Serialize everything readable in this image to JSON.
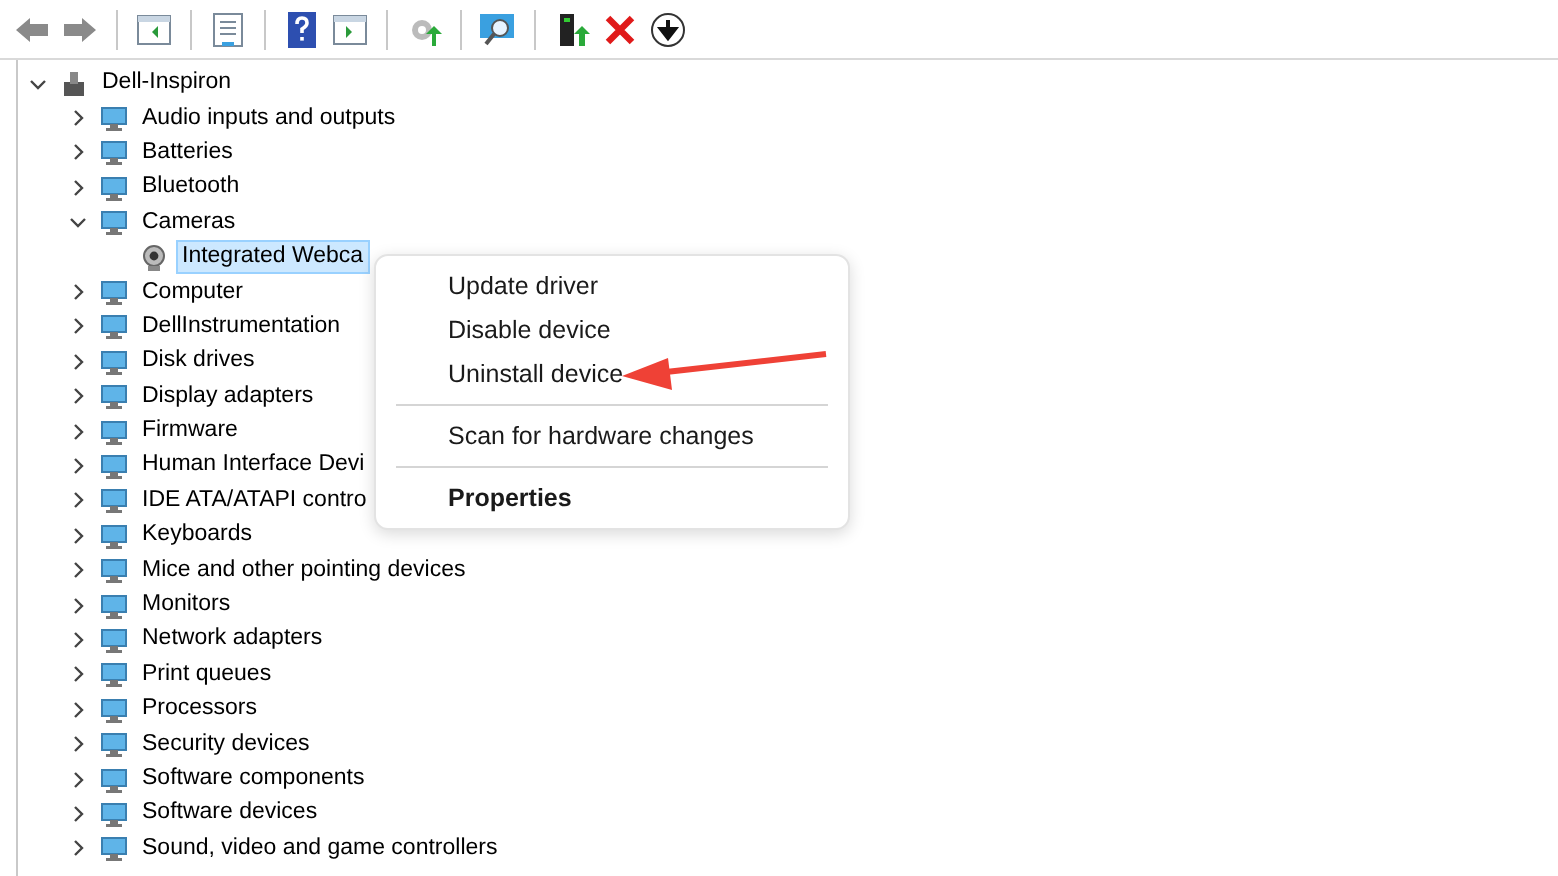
{
  "tree": {
    "label": "Dell-Inspiron",
    "expanded": true,
    "children": [
      {
        "label": "Audio inputs and outputs",
        "expanded": false
      },
      {
        "label": "Batteries",
        "expanded": false
      },
      {
        "label": "Bluetooth",
        "expanded": false
      },
      {
        "label": "Cameras",
        "expanded": true,
        "children": [
          {
            "label": "Integrated Webca",
            "selected": true
          }
        ]
      },
      {
        "label": "Computer",
        "expanded": false
      },
      {
        "label": "DellInstrumentation",
        "expanded": false
      },
      {
        "label": "Disk drives",
        "expanded": false
      },
      {
        "label": "Display adapters",
        "expanded": false
      },
      {
        "label": "Firmware",
        "expanded": false
      },
      {
        "label": "Human Interface Devi",
        "expanded": false
      },
      {
        "label": "IDE ATA/ATAPI contro",
        "expanded": false
      },
      {
        "label": "Keyboards",
        "expanded": false
      },
      {
        "label": "Mice and other pointing devices",
        "expanded": false
      },
      {
        "label": "Monitors",
        "expanded": false
      },
      {
        "label": "Network adapters",
        "expanded": false
      },
      {
        "label": "Print queues",
        "expanded": false
      },
      {
        "label": "Processors",
        "expanded": false
      },
      {
        "label": "Security devices",
        "expanded": false
      },
      {
        "label": "Software components",
        "expanded": false
      },
      {
        "label": "Software devices",
        "expanded": false
      },
      {
        "label": "Sound, video and game controllers",
        "expanded": false
      }
    ]
  },
  "context_menu": [
    {
      "label": "Update driver",
      "separator_before": false,
      "default": false
    },
    {
      "label": "Disable device",
      "separator_before": false,
      "default": false
    },
    {
      "label": "Uninstall device",
      "separator_before": false,
      "default": false
    },
    {
      "label": "Scan for hardware changes",
      "separator_before": true,
      "default": false
    },
    {
      "label": "Properties",
      "separator_before": true,
      "default": true
    }
  ]
}
